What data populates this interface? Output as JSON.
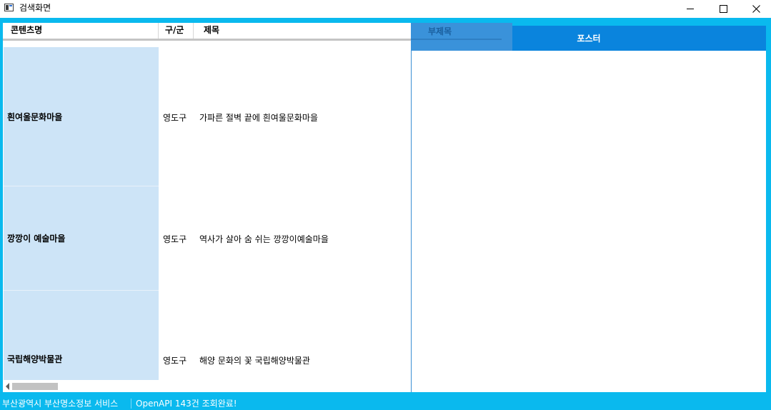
{
  "window": {
    "title": "검색화면",
    "minimize_icon": "minimize-icon",
    "maximize_icon": "maximize-icon",
    "close_icon": "close-icon"
  },
  "grid": {
    "columns": [
      "콘텐츠명",
      "구/군",
      "제목"
    ],
    "rows": [
      {
        "name": "흰여울문화마을",
        "gu": "영도구",
        "title": "가파른 절벽 끝에 흰여울문화마을"
      },
      {
        "name": "깡깡이 예술마을",
        "gu": "영도구",
        "title": "역사가 살아 숨 쉬는 깡깡이예술마을"
      },
      {
        "name": "국립해양박물관",
        "gu": "영도구",
        "title": "해양 문화의 꽃 국립해양박물관"
      }
    ]
  },
  "poster": {
    "subtitle_header": "부제목",
    "header": "포스터"
  },
  "status": {
    "left": "부산광역시 부산명소정보 서비스",
    "right": "OpenAPI 143건 조회완료!"
  },
  "colors": {
    "frame": "#0ab9ee",
    "row_highlight": "#cde4f7",
    "poster_header": "#0a84dd"
  }
}
